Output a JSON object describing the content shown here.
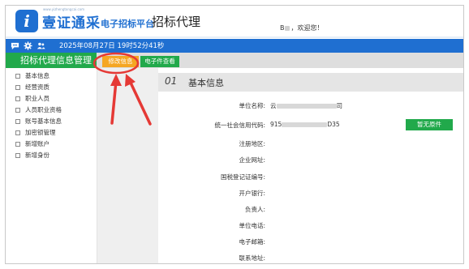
{
  "header": {
    "logo_glyph": "i",
    "brand_name": "壹证通采",
    "brand_sub": "www.yizhengtongcai.com",
    "platform_label": "电子招标平台",
    "module_title": "招标代理",
    "welcome": "，欢迎您！",
    "user_initial": "B"
  },
  "topbar": {
    "icons": [
      "chat-icon",
      "gear-icon",
      "users-icon"
    ],
    "datetime": "2025年08月27日 19时52分41秒"
  },
  "sidebar": {
    "title": "招标代理信息管理",
    "items": [
      {
        "label": "基本信息"
      },
      {
        "label": "经营资质"
      },
      {
        "label": "职业人员"
      },
      {
        "label": "人员职业资格"
      },
      {
        "label": "账号基本信息"
      },
      {
        "label": "加密锁管理"
      },
      {
        "label": "新增账户"
      },
      {
        "label": "新增身份"
      }
    ]
  },
  "tabs": {
    "edit": "修改信息",
    "doc": "电子件查看"
  },
  "section": {
    "number": "01",
    "title": "基本信息"
  },
  "fields": [
    {
      "label": "单位名称:",
      "value_prefix": "云",
      "value_suffix": "司"
    },
    {
      "label": "统一社会信用代码:",
      "value_prefix": "915",
      "value_suffix": "D35"
    },
    {
      "label": "注册地区:",
      "value_prefix": "",
      "value_suffix": ""
    },
    {
      "label": "企业网址:",
      "value_prefix": "",
      "value_suffix": ""
    },
    {
      "label": "国税登记证编号:",
      "value_prefix": "",
      "value_suffix": ""
    },
    {
      "label": "开户银行:",
      "value_prefix": "",
      "value_suffix": ""
    },
    {
      "label": "负责人:",
      "value_prefix": "",
      "value_suffix": ""
    },
    {
      "label": "单位电话:",
      "value_prefix": "",
      "value_suffix": ""
    },
    {
      "label": "电子邮箱:",
      "value_prefix": "",
      "value_suffix": ""
    },
    {
      "label": "联系地址:",
      "value_prefix": "",
      "value_suffix": ""
    }
  ],
  "actions": {
    "no_original": "暂无原件"
  },
  "colors": {
    "brand_blue": "#1f6fd1",
    "green": "#21a94b",
    "orange": "#f5a623",
    "annotation_red": "#e53935"
  }
}
